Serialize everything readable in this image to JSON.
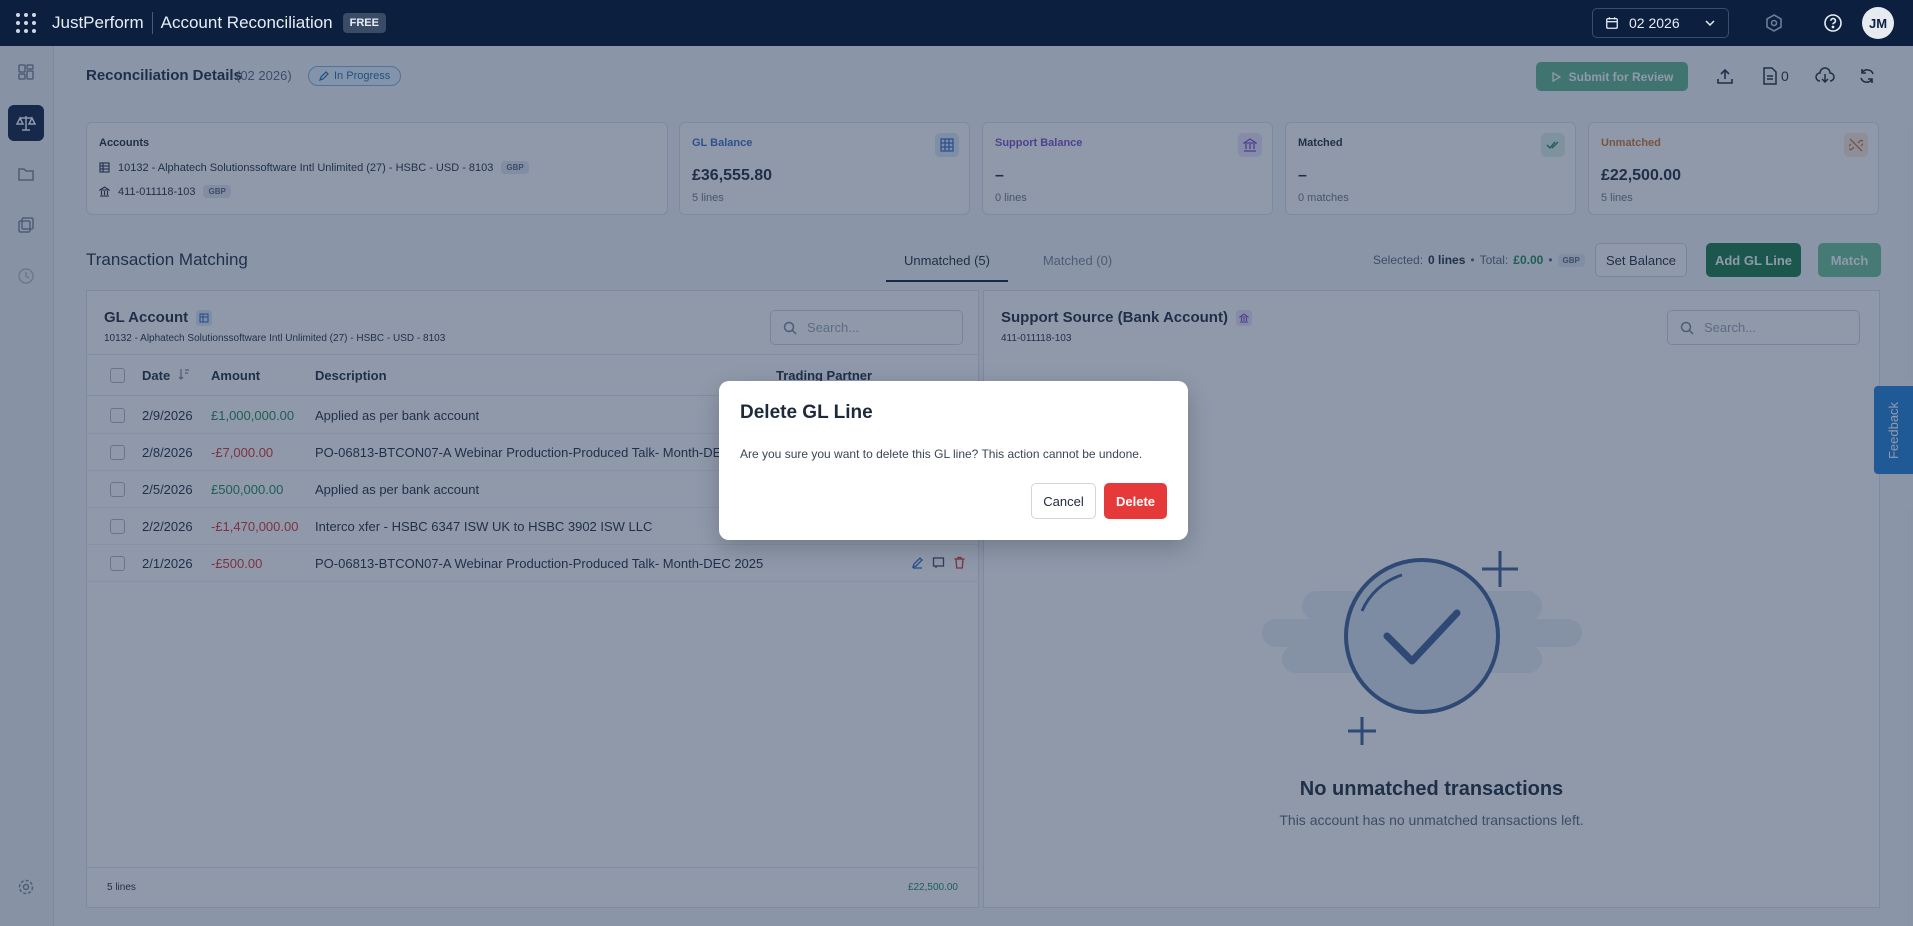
{
  "topbar": {
    "brand": "JustPerform",
    "app_title": "Account Reconciliation",
    "plan_badge": "FREE",
    "period": "02 2026",
    "avatar_initials": "JM"
  },
  "header": {
    "title": "Reconciliation Details",
    "period": "(02 2026)",
    "status": "In Progress",
    "submit_label": "Submit for Review",
    "attachments_count": "0"
  },
  "accounts_card": {
    "label": "Accounts",
    "gl_account": "10132 - Alphatech Solutionssoftware Intl Unlimited (27) - HSBC - USD - 8103",
    "gl_currency": "GBP",
    "bank_account": "411-011118-103",
    "bank_currency": "GBP"
  },
  "summary_cards": {
    "gl_balance": {
      "label": "GL Balance",
      "value": "£36,555.80",
      "sub": "5 lines",
      "color": "#3d6fc4"
    },
    "support_balance": {
      "label": "Support Balance",
      "value": "–",
      "sub": "0 lines",
      "color": "#7a4fc9"
    },
    "matched": {
      "label": "Matched",
      "value": "–",
      "sub": "0 matches",
      "color": "#1e2a3b"
    },
    "unmatched": {
      "label": "Unmatched",
      "value": "£22,500.00",
      "sub": "5 lines",
      "color": "#d0742a"
    }
  },
  "matching": {
    "title": "Transaction Matching",
    "tab_unmatched": "Unmatched (5)",
    "tab_matched": "Matched (0)",
    "selected_label": "Selected:",
    "selected_value": "0 lines",
    "total_label": "Total:",
    "total_value": "£0.00",
    "currency": "GBP",
    "set_balance_label": "Set Balance",
    "add_gl_label": "Add GL Line",
    "match_label": "Match"
  },
  "gl_panel": {
    "title": "GL Account",
    "subtitle": "10132 - Alphatech Solutionssoftware Intl Unlimited (27) - HSBC - USD - 8103",
    "search_placeholder": "Search...",
    "columns": {
      "date": "Date",
      "amount": "Amount",
      "description": "Description",
      "trading_partner": "Trading Partner"
    },
    "rows": [
      {
        "date": "2/9/2026",
        "amount": "£1,000,000.00",
        "description": "Applied as per bank account",
        "sign": "pos"
      },
      {
        "date": "2/8/2026",
        "amount": "-£7,000.00",
        "description": "PO-06813-BTCON07-A Webinar Production-Produced Talk- Month-DEC 2025",
        "sign": "neg"
      },
      {
        "date": "2/5/2026",
        "amount": "£500,000.00",
        "description": "Applied as per bank account",
        "sign": "pos"
      },
      {
        "date": "2/2/2026",
        "amount": "-£1,470,000.00",
        "description": "Interco xfer - HSBC 6347 ISW UK to HSBC 3902 ISW LLC",
        "sign": "neg"
      },
      {
        "date": "2/1/2026",
        "amount": "-£500.00",
        "description": "PO-06813-BTCON07-A Webinar Production-Produced Talk- Month-DEC 2025",
        "sign": "neg"
      }
    ],
    "footer_count": "5 lines",
    "footer_total": "£22,500.00"
  },
  "support_panel": {
    "title": "Support Source (Bank Account)",
    "subtitle": "411-011118-103",
    "search_placeholder": "Search...",
    "empty_title": "No unmatched transactions",
    "empty_sub": "This account has no unmatched transactions left."
  },
  "feedback_label": "Feedback",
  "modal": {
    "title": "Delete GL Line",
    "message": "Are you sure you want to delete this GL line? This action cannot be undone.",
    "cancel_label": "Cancel",
    "delete_label": "Delete"
  },
  "icons": [
    "apps-grid-icon",
    "calendar-icon",
    "chevron-down-icon",
    "hexagon-icon",
    "help-icon",
    "dashboard-icon",
    "scale-icon",
    "folder-icon",
    "copy-icon",
    "history-icon",
    "settings-icon",
    "pencil-icon",
    "play-icon",
    "upload-icon",
    "document-icon",
    "download-icon",
    "refresh-icon",
    "table-icon",
    "bank-icon",
    "double-check-icon",
    "unlink-icon",
    "sort-icon",
    "search-icon",
    "edit-icon",
    "split-icon",
    "trash-icon"
  ]
}
